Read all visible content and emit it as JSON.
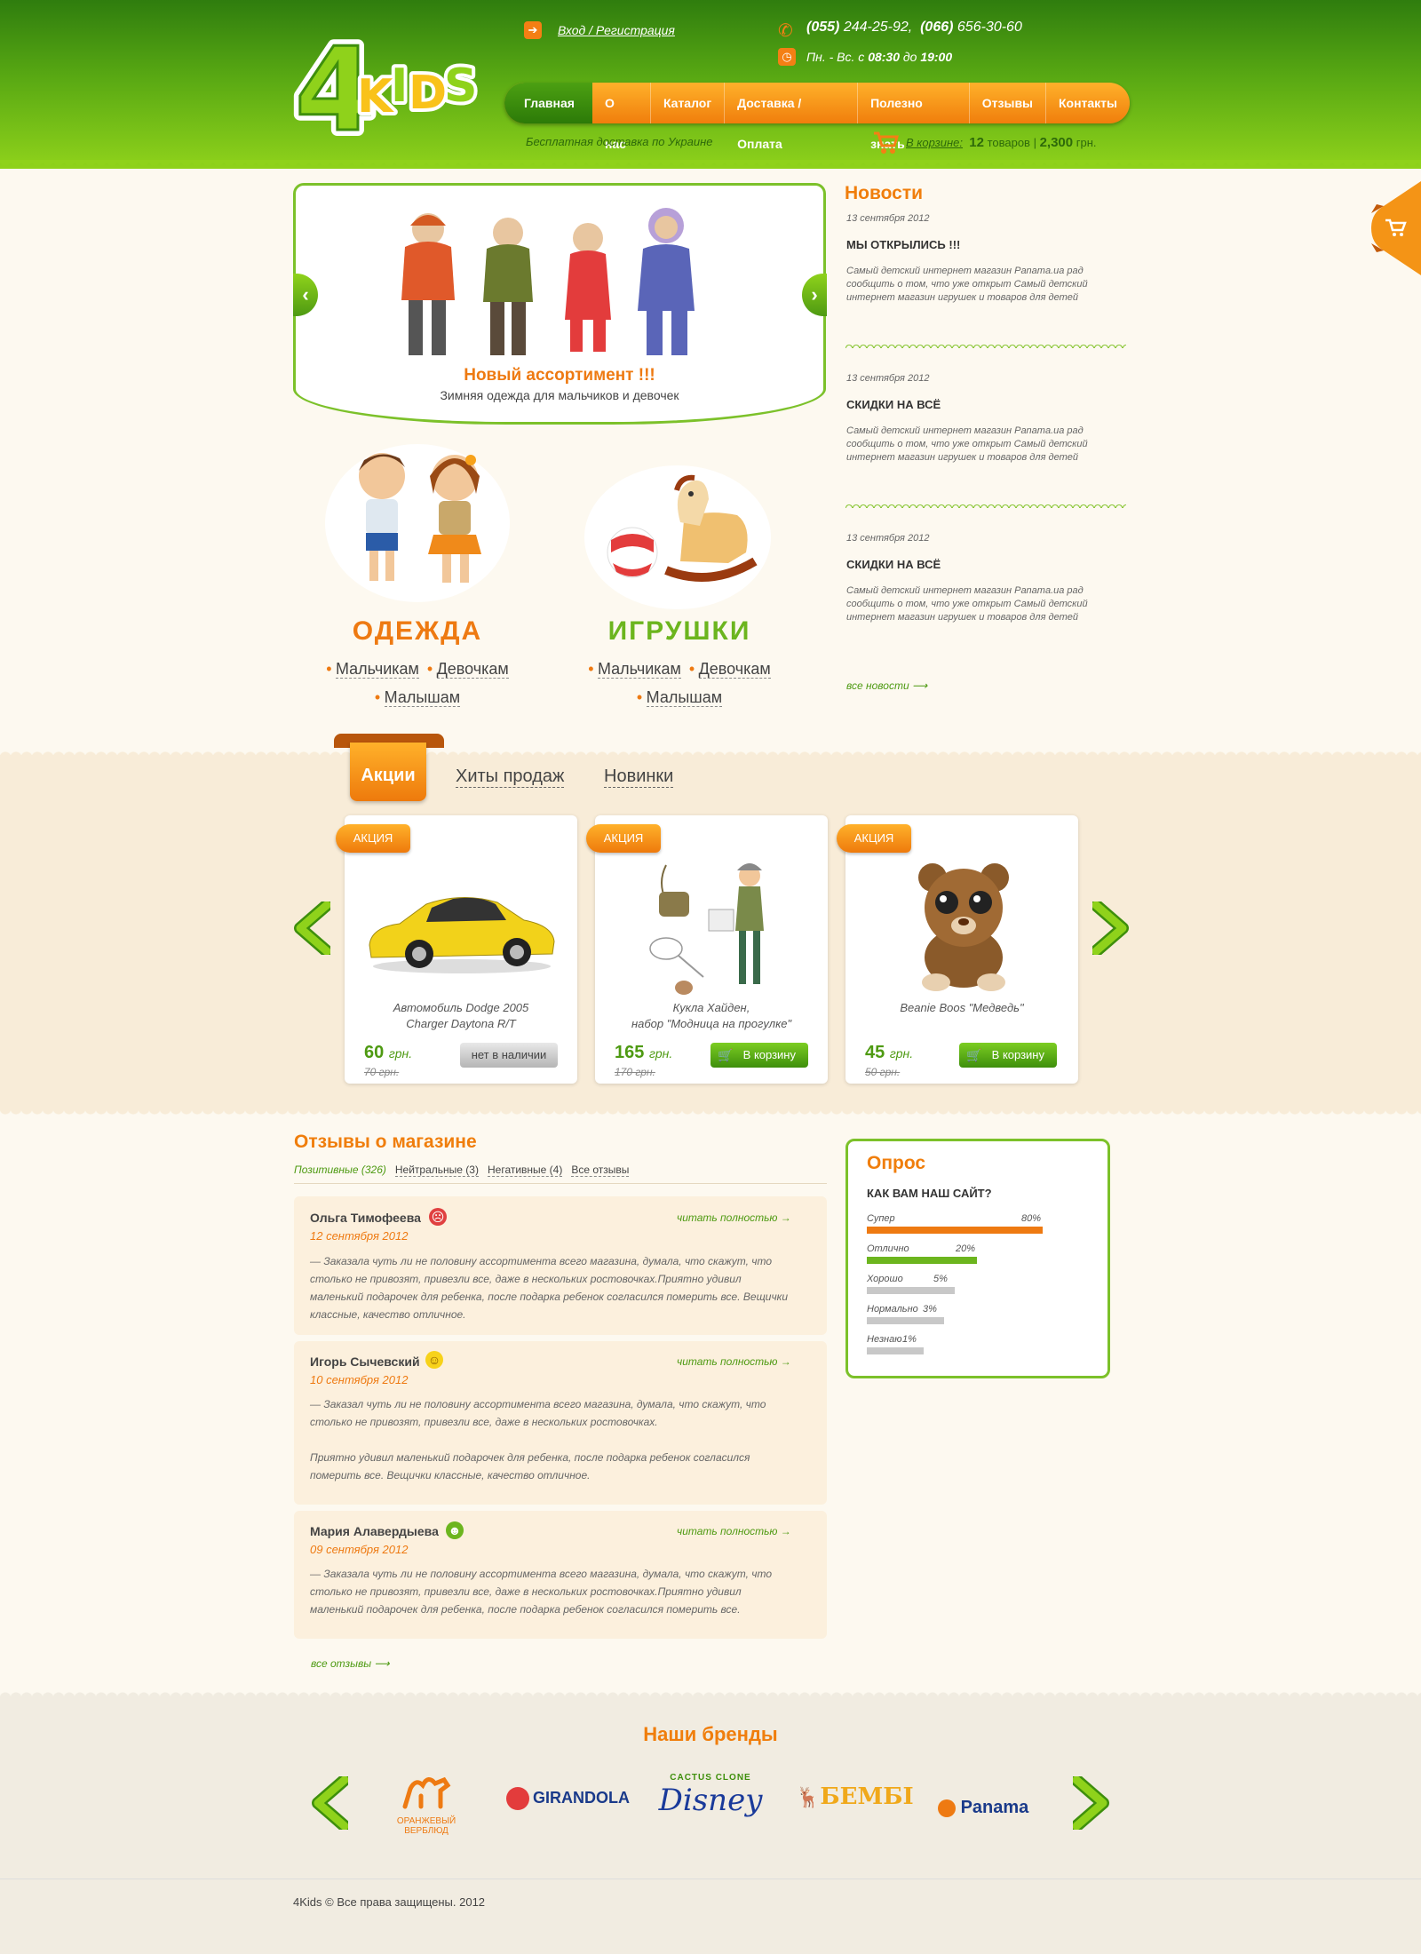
{
  "header": {
    "logo_text": "4KIDS",
    "login_link": "Вход / Регистрация",
    "phone1_code": "(055)",
    "phone1_number": "244-25-92,",
    "phone2_code": "(066)",
    "phone2_number": "656-30-60",
    "hours_prefix": "Пн. - Вс. с",
    "hours_from": "08:30",
    "hours_mid": "до",
    "hours_to": "19:00",
    "free_delivery": "Бесплатная доставка по Украине",
    "cart_label": "В корзине:",
    "cart_count": "12",
    "cart_count_unit": "товаров",
    "cart_sum": "2,300",
    "cart_currency": "грн.",
    "nav": [
      "Главная",
      "О нас",
      "Каталог",
      "Доставка / Оплата",
      "Полезно знать",
      "Отзывы",
      "Контакты"
    ]
  },
  "slider": {
    "title": "Новый ассортимент !!!",
    "subtitle": "Зимняя одежда для мальчиков и девочек"
  },
  "categories": [
    {
      "title": "ОДЕЖДА",
      "links": [
        "Мальчикам",
        "Девочкам",
        "Малышам"
      ]
    },
    {
      "title": "ИГРУШКИ",
      "links": [
        "Мальчикам",
        "Девочкам",
        "Малышам"
      ]
    }
  ],
  "news": {
    "heading": "Новости",
    "items": [
      {
        "date": "13 сентября 2012",
        "title": "МЫ ОТКРЫЛИСЬ !!!",
        "text": "Самый детский интернет магазин Panama.ua рад сообщить о том, что уже открыт Самый детский интернет магазин игрушек и товаров для детей"
      },
      {
        "date": "13 сентября 2012",
        "title": "СКИДКИ НА ВСЁ",
        "text": "Самый детский интернет магазин Panama.ua рад сообщить о том, что уже открыт Самый детский интернет магазин игрушек и товаров для детей"
      },
      {
        "date": "13 сентября 2012",
        "title": "СКИДКИ НА ВСЁ",
        "text": "Самый детский интернет магазин Panama.ua рад сообщить о том, что уже открыт Самый детский интернет магазин игрушек и товаров для детей"
      }
    ],
    "all_link": "все новости ⟶"
  },
  "promo": {
    "tabs": [
      "Акции",
      "Хиты продаж",
      "Новинки"
    ],
    "products": [
      {
        "badge": "АКЦИЯ",
        "name1": "Автомобиль Dodge 2005",
        "name2": "Charger Daytona R/T",
        "price": "60",
        "currency": "грн.",
        "old_price": "70 грн.",
        "button": "нет в наличии",
        "available": false
      },
      {
        "badge": "АКЦИЯ",
        "name1": "Кукла Хайден,",
        "name2": "набор \"Модница на прогулке\"",
        "price": "165",
        "currency": "грн.",
        "old_price": "170 грн.",
        "button": "В корзину",
        "available": true
      },
      {
        "badge": "АКЦИЯ",
        "name1": "Beanie Boos \"Медведь\"",
        "name2": "",
        "price": "45",
        "currency": "грн.",
        "old_price": "50 грн.",
        "button": "В корзину",
        "available": true
      }
    ]
  },
  "reviews": {
    "heading": "Отзывы о магазине",
    "filters": [
      "Позитивные (326)",
      "Нейтральные (3)",
      "Негативные (4)",
      "Все отзывы"
    ],
    "items": [
      {
        "name": "Ольга Тимофеева",
        "date": "12 сентября 2012",
        "more": "читать полностью →",
        "text": "— Заказала чуть ли не половину ассортимента всего магазина, думала, что скажут, что столько не привозят, привезли все, даже в нескольких ростовочках.Приятно удивил маленький подарочек для ребенка, после подарка ребенок согласился померить все. Вещички классные, качество отличное.",
        "text2": ""
      },
      {
        "name": "Игорь Сычевский",
        "date": "10 сентября 2012",
        "more": "читать полностью →",
        "text": "— Заказал чуть ли не половину ассортимента всего магазина, думала, что скажут, что столько не привозят, привезли все, даже в нескольких ростовочках.",
        "text2": "Приятно удивил маленький подарочек для ребенка, после подарка ребенок согласился померить все. Вещички классные, качество отличное."
      },
      {
        "name": "Мария Алавердыева",
        "date": "09 сентября 2012",
        "more": "читать полностью →",
        "text": "— Заказала чуть ли не половину ассортимента всего магазина, думала, что скажут, что столько не привозят, привезли все, даже в нескольких ростовочках.Приятно удивил маленький подарочек для ребенка, после подарка ребенок согласился померить все.",
        "text2": ""
      }
    ],
    "all_link": "все отзывы ⟶"
  },
  "poll": {
    "heading": "Опрос",
    "question": "КАК ВАМ НАШ САЙТ?",
    "options": [
      {
        "label": "Супер",
        "percent": "80%",
        "value": 0.8,
        "color": "#ee7a12"
      },
      {
        "label": "Отлично",
        "percent": "20%",
        "value": 0.5,
        "color": "#6cb51e"
      },
      {
        "label": "Хорошо",
        "percent": "5%",
        "value": 0.4,
        "color": "#c8c8c8"
      },
      {
        "label": "Нормально",
        "percent": "3%",
        "value": 0.35,
        "color": "#c8c8c8"
      },
      {
        "label": "Незнаю",
        "percent": "1%",
        "value": 0.26,
        "color": "#c8c8c8"
      }
    ]
  },
  "brands": {
    "heading": "Наши бренды",
    "items": [
      "ОРАНЖЕВЫЙ ВЕРБЛЮД",
      "GIRANDOLA",
      "CACTUS CLONE",
      "Disney",
      "БЕМБІ",
      "Panama"
    ]
  },
  "footer": {
    "copyright": "4Kids © Все права защищены. 2012"
  }
}
